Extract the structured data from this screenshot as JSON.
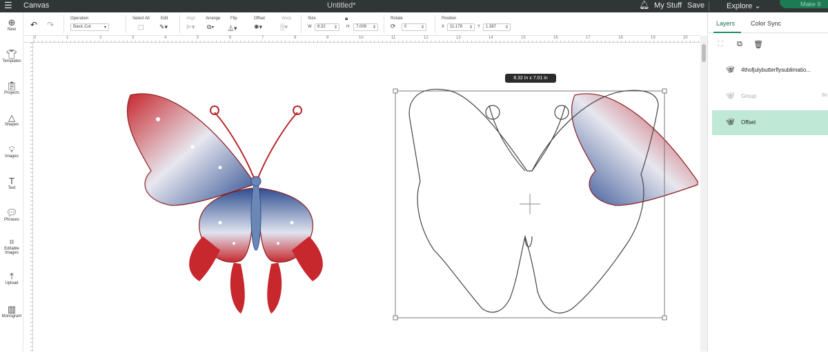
{
  "topbar": {
    "menu_icon": "hamburger-icon",
    "app_title": "Canvas",
    "doc_title": "Untitled*",
    "bell_icon": "bell-icon",
    "my_stuff": "My Stuff",
    "save": "Save",
    "explore": "Explore",
    "make_it": "Make It"
  },
  "sidebar": {
    "items": [
      {
        "label": "New",
        "icon": "plus-circle-icon"
      },
      {
        "label": "Templates",
        "icon": "shirt-icon"
      },
      {
        "label": "Projects",
        "icon": "clipboard-icon"
      },
      {
        "label": "Shapes",
        "icon": "shapes-icon"
      },
      {
        "label": "Images",
        "icon": "lightbulb-icon"
      },
      {
        "label": "Text",
        "icon": "text-icon"
      },
      {
        "label": "Phrases",
        "icon": "speech-icon"
      },
      {
        "label": "Editable Images",
        "icon": "editable-image-icon"
      },
      {
        "label": "Upload",
        "icon": "upload-icon"
      },
      {
        "label": "Monogram",
        "icon": "monogram-icon"
      }
    ]
  },
  "toolbar": {
    "operation_label": "Operation",
    "operation_value": "Basic Cut",
    "select_all": "Select All",
    "edit": "Edit",
    "align": "Align",
    "arrange": "Arrange",
    "flip": "Flip",
    "offset": "Offset",
    "warp": "Warp",
    "size_label": "Size",
    "w_label": "W",
    "w_value": "8.32",
    "h_label": "H",
    "h_value": "7.009",
    "rotate_label": "Rotate",
    "rotate_value": "0",
    "position_label": "Position",
    "x_label": "X",
    "x_value": "11.178",
    "y_label": "Y",
    "y_value": "1.387"
  },
  "ruler": {
    "ticks": [
      "0",
      "1",
      "2",
      "3",
      "4",
      "5",
      "6",
      "7",
      "8",
      "9",
      "10",
      "11",
      "12",
      "13",
      "14",
      "15",
      "16",
      "17",
      "18",
      "19",
      "20"
    ]
  },
  "canvas": {
    "dim_tooltip": "8.32  in x 7.01  in"
  },
  "panel": {
    "tab_layers": "Layers",
    "tab_color_sync": "Color Sync",
    "layers": [
      {
        "name": "4thofjulybutterflysublimatio...",
        "icon": "butterfly-icon"
      },
      {
        "name": "Group",
        "icon": "butterfly-icon",
        "value": "60"
      },
      {
        "name": "Offset",
        "icon": "butterfly-outline-icon"
      }
    ]
  },
  "colors": {
    "accent": "#1f8a64",
    "selected_layer": "#bfe8d7",
    "topbar": "#303536",
    "red": "#c7282e",
    "blue": "#2f4e91"
  }
}
